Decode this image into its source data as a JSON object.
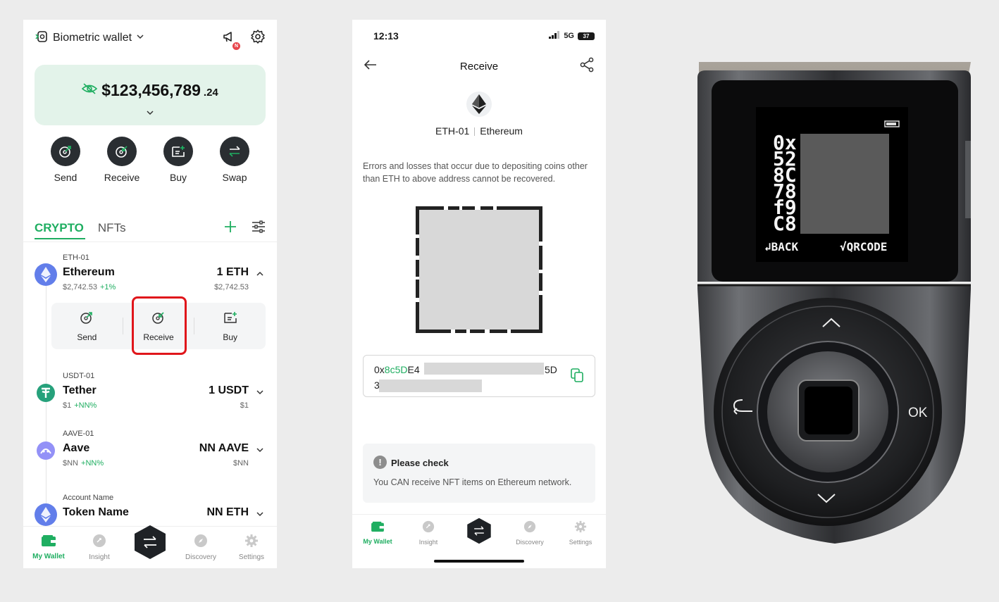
{
  "phone1": {
    "wallet_name": "Biometric wallet",
    "notification_badge": "N",
    "balance_main": "$123,456,789",
    "balance_decimal": ".24",
    "actions": [
      {
        "label": "Send",
        "icon": "send-icon"
      },
      {
        "label": "Receive",
        "icon": "receive-icon"
      },
      {
        "label": "Buy",
        "icon": "buy-icon"
      },
      {
        "label": "Swap",
        "icon": "swap-icon"
      }
    ],
    "tabs": [
      {
        "label": "CRYPTO",
        "active": true
      },
      {
        "label": "NFTs",
        "active": false
      }
    ],
    "assets": [
      {
        "account": "ETH-01",
        "name": "Ethereum",
        "price": "$2,742.53",
        "change": "+1%",
        "amount": "1 ETH",
        "value": "$2,742.53",
        "icon_color": "#627eea",
        "expanded": true
      },
      {
        "account": "USDT-01",
        "name": "Tether",
        "price": "$1",
        "change": "+NN%",
        "amount": "1 USDT",
        "value": "$1",
        "icon_color": "#26a17b",
        "expanded": false
      },
      {
        "account": "AAVE-01",
        "name": "Aave",
        "price": "$NN",
        "change": "+NN%",
        "amount": "NN AAVE",
        "value": "$NN",
        "icon_color": "#9391f7",
        "expanded": false
      },
      {
        "account": "Account Name",
        "name": "Token Name",
        "price": "",
        "change": "",
        "amount": "NN ETH",
        "value": "",
        "icon_color": "#627eea",
        "expanded": false
      }
    ],
    "sub_actions": [
      {
        "label": "Send"
      },
      {
        "label": "Receive",
        "highlighted": true
      },
      {
        "label": "Buy"
      }
    ],
    "bottom_nav": [
      {
        "label": "My Wallet",
        "icon": "wallet-icon",
        "active": true
      },
      {
        "label": "Insight",
        "icon": "insight-icon",
        "active": false
      },
      {
        "label": "",
        "icon": "swap-hexagon-icon",
        "active": false
      },
      {
        "label": "Discovery",
        "icon": "compass-icon",
        "active": false
      },
      {
        "label": "Settings",
        "icon": "gear-icon",
        "active": false
      }
    ]
  },
  "phone2": {
    "status_time": "12:13",
    "network": "5G",
    "battery": "37",
    "title": "Receive",
    "coin_account": "ETH-01",
    "coin_name": "Ethereum",
    "warning": "Errors and losses that occur due to depositing coins other than ETH to above address cannot be recovered.",
    "address_prefix": "0x",
    "address_green": "8c5D",
    "address_after": "E4",
    "address_tail": "5D",
    "address_line2": "3",
    "check_title": "Please check",
    "check_body": "You CAN receive NFT items on Ethereum network.",
    "bottom_nav": [
      {
        "label": "My Wallet",
        "active": true
      },
      {
        "label": "Insight",
        "active": false
      },
      {
        "label": "",
        "active": false
      },
      {
        "label": "Discovery",
        "active": false
      },
      {
        "label": "Settings",
        "active": false
      }
    ]
  },
  "device": {
    "screen_lines": [
      "0x",
      "52",
      "8C",
      "78",
      "f9",
      "C8"
    ],
    "back_label": "↲BACK",
    "qrcode_label": "√QRCODE",
    "ok_label": "OK"
  },
  "colors": {
    "accent": "#1fae61",
    "highlight": "#e0161b",
    "balance_bg": "#e3f3ea",
    "dark_button": "#2a2e32"
  }
}
